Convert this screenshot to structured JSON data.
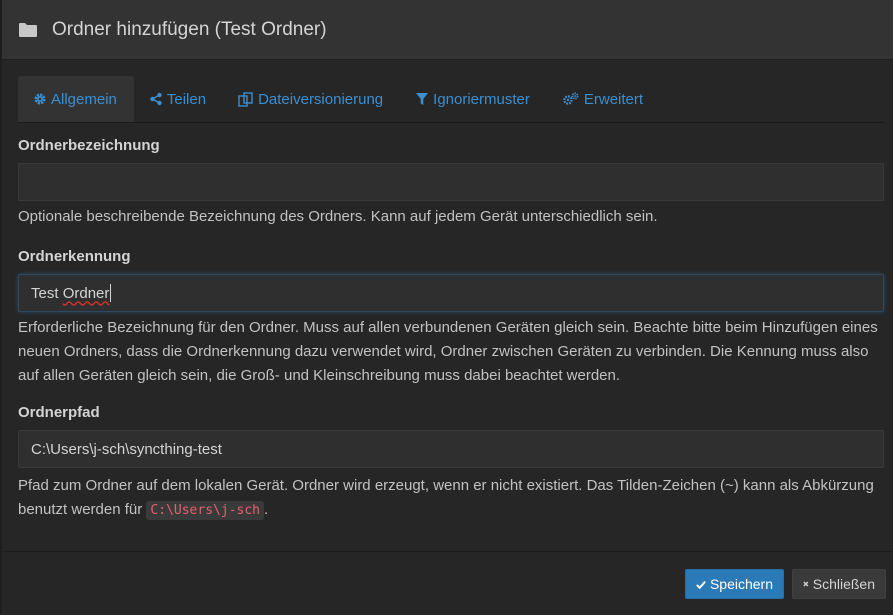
{
  "dialog": {
    "title": "Ordner hinzufügen (Test Ordner)"
  },
  "tabs": [
    {
      "label": "Allgemein",
      "icon": "gear-icon",
      "active": true
    },
    {
      "label": "Teilen",
      "icon": "share-icon"
    },
    {
      "label": "Dateiversionierung",
      "icon": "copy-icon"
    },
    {
      "label": "Ignoriermuster",
      "icon": "filter-icon"
    },
    {
      "label": "Erweitert",
      "icon": "gears-icon"
    }
  ],
  "fields": {
    "label": {
      "title": "Ordnerbezeichnung",
      "value": "",
      "help": "Optionale beschreibende Bezeichnung des Ordners. Kann auf jedem Gerät unterschiedlich sein."
    },
    "id": {
      "title": "Ordnerkennung",
      "value_prefix": "Test ",
      "value_word": "Ordner",
      "help": "Erforderliche Bezeichnung für den Ordner. Muss auf allen verbundenen Geräten gleich sein. Beachte bitte beim Hinzufügen eines neuen Ordners, dass die Ordnerkennung dazu verwendet wird, Ordner zwischen Geräten zu verbinden. Die Kennung muss also auf allen Geräten gleich sein, die Groß- und Kleinschreibung muss dabei beachtet werden."
    },
    "path": {
      "title": "Ordnerpfad",
      "value": "C:\\Users\\j-sch\\syncthing-test",
      "help_before": "Pfad zum Ordner auf dem lokalen Gerät. Ordner wird erzeugt, wenn er nicht existiert. Das Tilden-Zeichen (~) kann als Abkürzung benutzt werden für ",
      "help_code": "C:\\Users\\j-sch",
      "help_after": "."
    }
  },
  "footer": {
    "save_label": "Speichern",
    "close_label": "Schließen"
  },
  "colors": {
    "accent": "#3b8ed0",
    "primary_button": "#2a7ab8",
    "code_text": "#e65f6f"
  }
}
